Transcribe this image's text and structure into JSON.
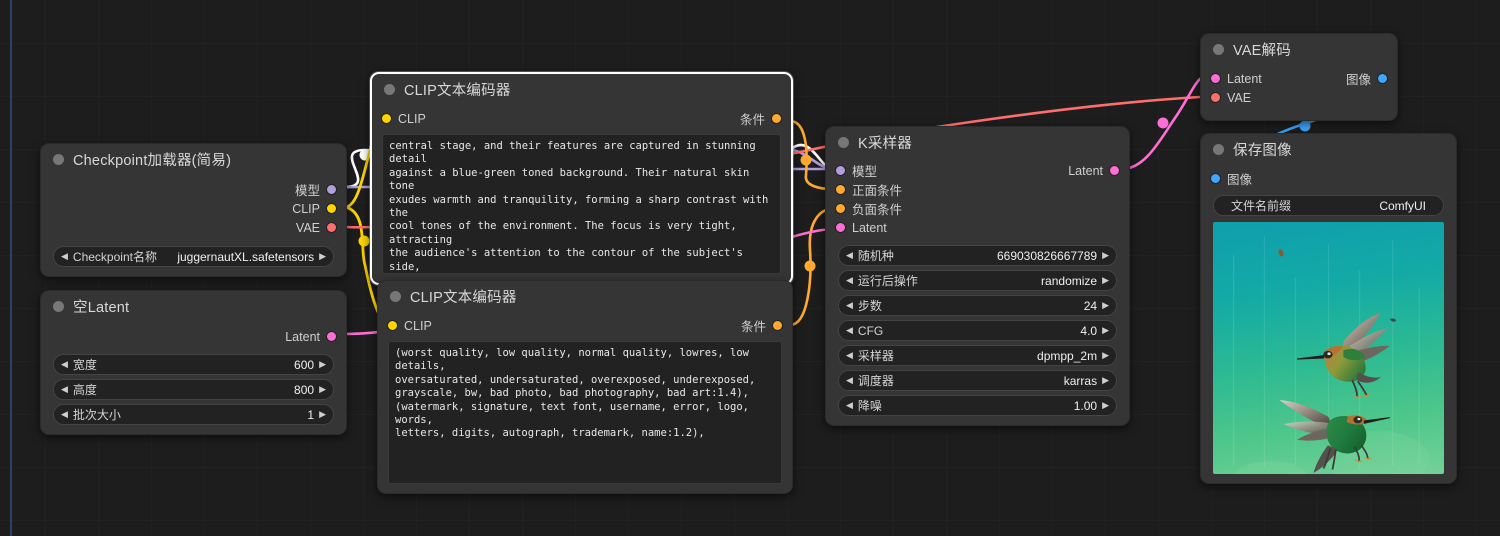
{
  "app": {
    "name": "ComfyUI",
    "canvas_bg": "#1d1d1d"
  },
  "link_colors": {
    "model": "#b39ddb",
    "clip": "#ffd500",
    "vae": "#ff6e6e",
    "conditioning": "#ffa931",
    "latent": "#ff6ed4",
    "image": "#3fa7ff",
    "selected": "#ffffff"
  },
  "nodes": {
    "checkpoint_loader": {
      "title": "Checkpoint加载器(简易)",
      "outputs": [
        {
          "label": "模型",
          "type": "model"
        },
        {
          "label": "CLIP",
          "type": "clip"
        },
        {
          "label": "VAE",
          "type": "vae"
        }
      ],
      "widgets": [
        {
          "name": "Checkpoint名称",
          "value": "juggernautXL.safetensors"
        }
      ]
    },
    "empty_latent": {
      "title": "空Latent",
      "outputs": [
        {
          "label": "Latent",
          "type": "latent"
        }
      ],
      "widgets": [
        {
          "name": "宽度",
          "value": "600"
        },
        {
          "name": "高度",
          "value": "800"
        },
        {
          "name": "批次大小",
          "value": "1"
        }
      ]
    },
    "clip_positive": {
      "title": "CLIP文本编码器",
      "selected": true,
      "input": {
        "label": "CLIP",
        "type": "clip"
      },
      "output": {
        "label": "条件",
        "type": "conditioning"
      },
      "text": "central stage, and their features are captured in stunning detail\nagainst a blue-green toned background. Their natural skin tone\nexudes warmth and tranquility, forming a sharp contrast with the\ncool tones of the environment. The focus is very tight, attracting\nthe audience's attention to the contour of the subject's side,\ncreating a sense of intimacy and depth. In the above picture,\nbirds gracefully dance in the dark sky, and their movements add a\nsurreal calmness to the scene. This juxtaposition is a powerful\nvisual metaphor, symbolizing the subtle balance between the\nethereal and the mundane."
    },
    "clip_negative": {
      "title": "CLIP文本编码器",
      "selected": false,
      "input": {
        "label": "CLIP",
        "type": "clip"
      },
      "output": {
        "label": "条件",
        "type": "conditioning"
      },
      "text": "(worst quality, low quality, normal quality, lowres, low details,\noversaturated, undersaturated, overexposed, underexposed,\ngrayscale, bw, bad photo, bad photography, bad art:1.4),\n(watermark, signature, text font, username, error, logo, words,\nletters, digits, autograph, trademark, name:1.2),"
    },
    "ksampler": {
      "title": "K采样器",
      "inputs": [
        {
          "label": "模型",
          "type": "model"
        },
        {
          "label": "正面条件",
          "type": "conditioning"
        },
        {
          "label": "负面条件",
          "type": "conditioning"
        },
        {
          "label": "Latent",
          "type": "latent"
        }
      ],
      "outputs": [
        {
          "label": "Latent",
          "type": "latent"
        }
      ],
      "widgets": [
        {
          "name": "随机种",
          "value": "669030826667789"
        },
        {
          "name": "运行后操作",
          "value": "randomize"
        },
        {
          "name": "步数",
          "value": "24"
        },
        {
          "name": "CFG",
          "value": "4.0"
        },
        {
          "name": "采样器",
          "value": "dpmpp_2m"
        },
        {
          "name": "调度器",
          "value": "karras"
        },
        {
          "name": "降噪",
          "value": "1.00"
        }
      ]
    },
    "vae_decode": {
      "title": "VAE解码",
      "inputs": [
        {
          "label": "Latent",
          "type": "latent"
        },
        {
          "label": "VAE",
          "type": "vae"
        }
      ],
      "outputs": [
        {
          "label": "图像",
          "type": "image"
        }
      ]
    },
    "save_image": {
      "title": "保存图像",
      "inputs": [
        {
          "label": "图像",
          "type": "image"
        }
      ],
      "widgets": [
        {
          "name": "文件名前缀",
          "value": "ComfyUI"
        }
      ],
      "preview": {
        "description": "two hummingbirds in flight against a teal to green gradient background",
        "bg_top": "#12a8a8",
        "bg_bottom": "#63c98a"
      }
    }
  }
}
